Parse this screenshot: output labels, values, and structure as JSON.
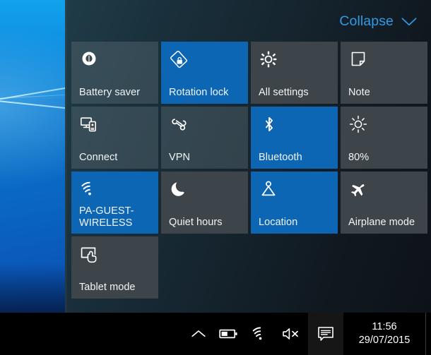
{
  "desktop": {
    "name": "windows-desktop-wallpaper"
  },
  "action_center": {
    "header": {
      "collapse_label": "Collapse",
      "chevron_icon": "chevron-down-icon"
    },
    "accent_color": "#0c66b3",
    "inactive_color": "#3e454a",
    "link_color": "#2f9ae8",
    "tiles": [
      {
        "label": "Battery saver",
        "icon": "battery-saver-icon",
        "state": "off",
        "style": "faded"
      },
      {
        "label": "Rotation lock",
        "icon": "rotation-lock-icon",
        "state": "on",
        "style": "active"
      },
      {
        "label": "All settings",
        "icon": "gear-icon",
        "state": "off",
        "style": "normal"
      },
      {
        "label": "Note",
        "icon": "note-icon",
        "state": "off",
        "style": "normal"
      },
      {
        "label": "Connect",
        "icon": "connect-icon",
        "state": "off",
        "style": "faded"
      },
      {
        "label": "VPN",
        "icon": "vpn-icon",
        "state": "off",
        "style": "faded"
      },
      {
        "label": "Bluetooth",
        "icon": "bluetooth-icon",
        "state": "on",
        "style": "active"
      },
      {
        "label": "80%",
        "icon": "brightness-icon",
        "state": "off",
        "style": "normal"
      },
      {
        "label": "PA-GUEST-WIRELESS",
        "icon": "wifi-icon",
        "state": "on",
        "style": "active"
      },
      {
        "label": "Quiet hours",
        "icon": "moon-icon",
        "state": "off",
        "style": "normal"
      },
      {
        "label": "Location",
        "icon": "location-icon",
        "state": "on",
        "style": "active"
      },
      {
        "label": "Airplane mode",
        "icon": "airplane-icon",
        "state": "off",
        "style": "normal"
      },
      {
        "label": "Tablet mode",
        "icon": "tablet-mode-icon",
        "state": "off",
        "style": "normal"
      }
    ]
  },
  "taskbar": {
    "background": "#000000",
    "tray": [
      {
        "name": "show-hidden-icons",
        "icon": "chevron-up-icon"
      },
      {
        "name": "battery",
        "icon": "battery-icon"
      },
      {
        "name": "network",
        "icon": "wifi-icon"
      },
      {
        "name": "volume",
        "icon": "speaker-muted-icon"
      },
      {
        "name": "action-center",
        "icon": "action-center-icon"
      }
    ],
    "clock": {
      "time": "11:56",
      "date": "29/07/2015"
    }
  }
}
